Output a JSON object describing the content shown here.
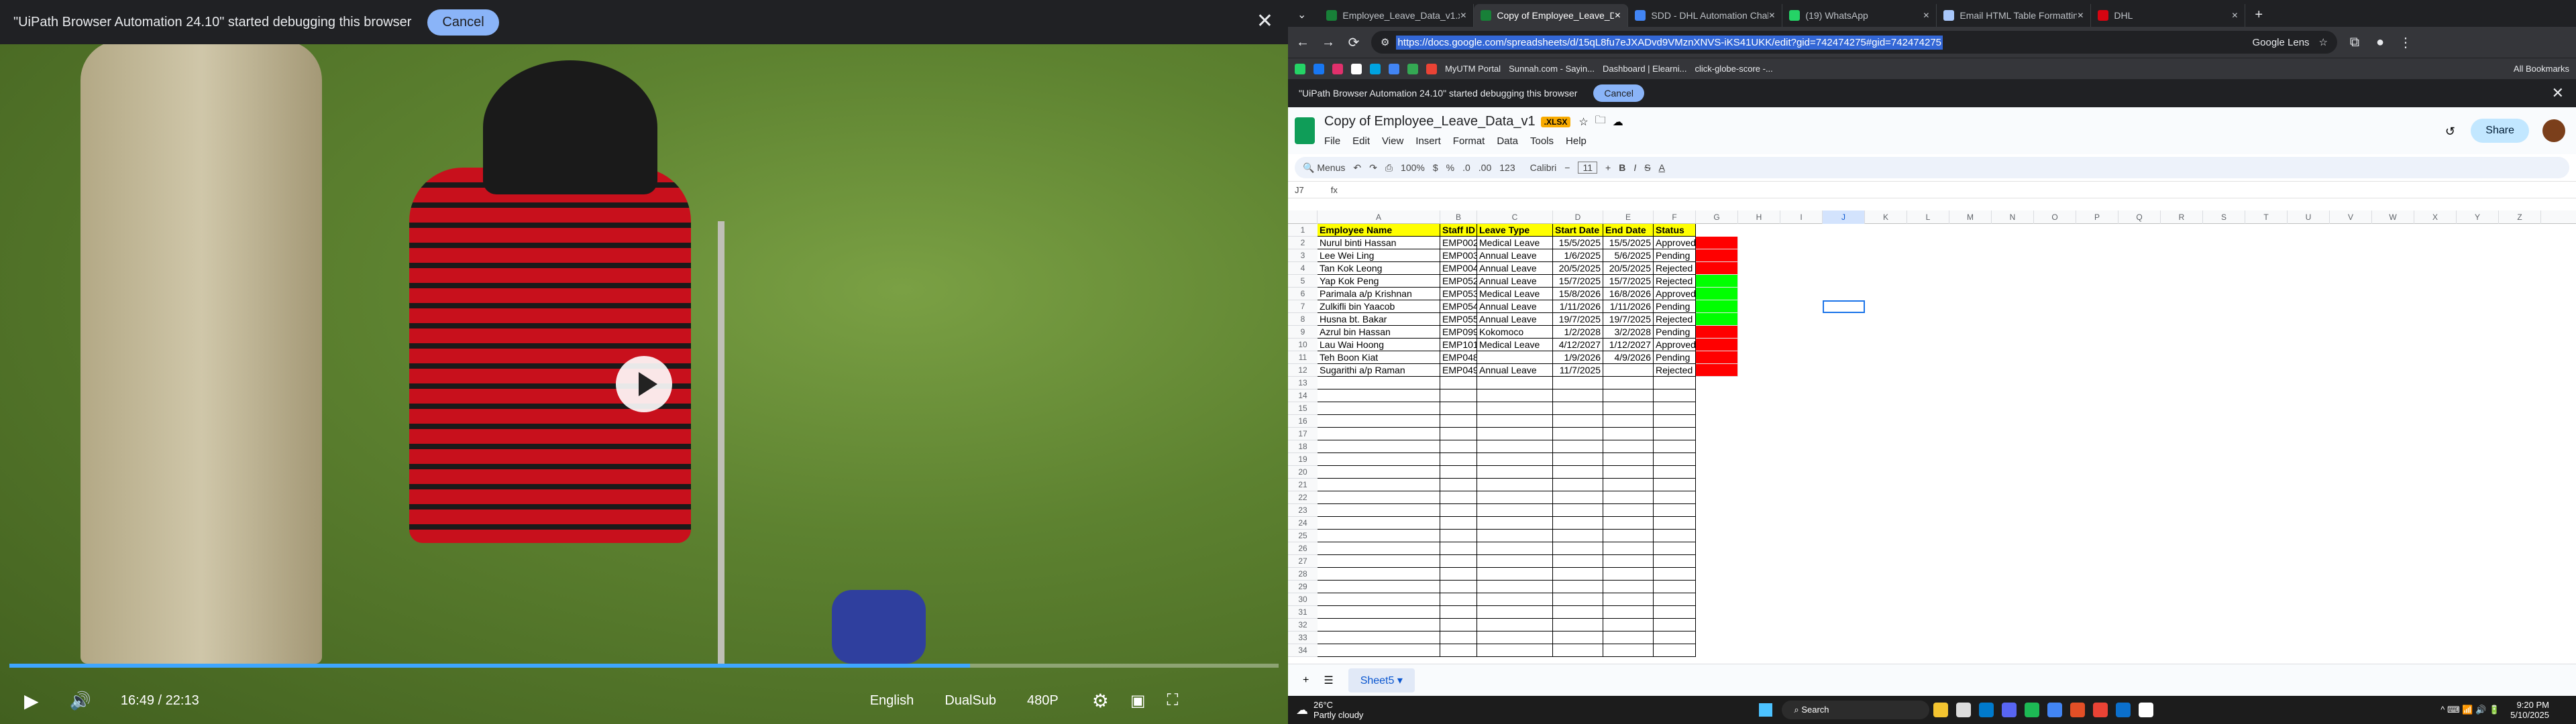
{
  "debug_banner": {
    "message": "\"UiPath Browser Automation 24.10\" started debugging this browser",
    "cancel": "Cancel"
  },
  "video": {
    "time": "16:49 / 22:13",
    "progress": 0.757,
    "audio_language": "English",
    "subtitle_mode": "DualSub",
    "quality": "480P"
  },
  "browser": {
    "tabs": [
      {
        "label": "Employee_Leave_Data_v1.xlsx",
        "color": "#188038"
      },
      {
        "label": "Copy of Employee_Leave_Data",
        "color": "#188038",
        "active": true
      },
      {
        "label": "SDD - DHL Automation Challe",
        "color": "#4285f4"
      },
      {
        "label": "(19) WhatsApp",
        "color": "#25d366"
      },
      {
        "label": "Email HTML Table Formatting",
        "color": "#a8c7fa"
      },
      {
        "label": "DHL",
        "color": "#d40511"
      }
    ],
    "url": "https://docs.google.com/spreadsheets/d/15qL8fu7eJXADvd9VMznXNVS-iKS41UKK/edit?gid=742474275#gid=742474275",
    "lens": "Google Lens",
    "bookmarks": [
      "MyUTM Portal",
      "Sunnah.com - Sayin...",
      "Dashboard | Elearni...",
      "click-globe-score -..."
    ],
    "all_bookmarks": "All Bookmarks"
  },
  "sheet": {
    "title": "Copy of Employee_Leave_Data_v1",
    "badge": ".XLSX",
    "menus": [
      "File",
      "Edit",
      "View",
      "Insert",
      "Format",
      "Data",
      "Tools",
      "Help"
    ],
    "share": "Share",
    "toolbar": {
      "menus": "Menus",
      "zoom": "100%",
      "currency": "$",
      "percent": "%",
      "dec_less": ".0",
      "dec_more": ".00",
      "num_fmt": "123",
      "font": "Calibri",
      "size": "11"
    },
    "namebox": "J7",
    "fx": "fx",
    "columns": [
      "A",
      "B",
      "C",
      "D",
      "E",
      "F",
      "G",
      "H",
      "I",
      "J",
      "K",
      "L",
      "M",
      "N",
      "O",
      "P",
      "Q",
      "R",
      "S",
      "T",
      "U",
      "V",
      "W",
      "X",
      "Y",
      "Z"
    ],
    "headers": [
      "Employee Name",
      "Staff ID",
      "Leave Type",
      "Start Date",
      "End Date",
      "Status"
    ],
    "rows": [
      [
        "Nurul binti Hassan",
        "EMP002",
        "Medical Leave",
        "15/5/2025",
        "15/5/2025",
        "Approved"
      ],
      [
        "Lee Wei Ling",
        "EMP003",
        "Annual Leave",
        "1/6/2025",
        "5/6/2025",
        "Pending"
      ],
      [
        "Tan Kok Leong",
        "EMP004",
        "Annual Leave",
        "20/5/2025",
        "20/5/2025",
        "Rejected"
      ],
      [
        "Yap Kok Peng",
        "EMP052",
        "Annual Leave",
        "15/7/2025",
        "15/7/2025",
        "Rejected"
      ],
      [
        "Parimala a/p Krishnan",
        "EMP053",
        "Medical Leave",
        "15/8/2026",
        "16/8/2026",
        "Approved"
      ],
      [
        "Zulkifli bin Yaacob",
        "EMP054",
        "Annual Leave",
        "1/11/2026",
        "1/11/2026",
        "Pending"
      ],
      [
        "Husna bt. Bakar",
        "EMP055",
        "Annual Leave",
        "19/7/2025",
        "19/7/2025",
        "Rejected"
      ],
      [
        "Azrul bin Hassan",
        "EMP099",
        "Kokomoco",
        "1/2/2028",
        "3/2/2028",
        "Pending"
      ],
      [
        "Lau Wai Hoong",
        "EMP101",
        "Medical Leave",
        "4/12/2027",
        "1/12/2027",
        "Approved"
      ],
      [
        "Teh Boon Kiat",
        "EMP048",
        "",
        "1/9/2026",
        "4/9/2026",
        "Pending"
      ],
      [
        "Sugarithi a/p Raman",
        "EMP049",
        "Annual Leave",
        "11/7/2025",
        "",
        "Rejected"
      ]
    ],
    "g_colors": [
      "#ff0000",
      "#ff0000",
      "#ff0000",
      "#00ff00",
      "#00ff00",
      "#00ff00",
      "#00ff00",
      "#ff0000",
      "#ff0000",
      "#ff0000",
      "#ff0000"
    ],
    "sheet_tab": "Sheet5"
  },
  "taskbar": {
    "weather_temp": "26°C",
    "weather_desc": "Partly cloudy",
    "search": "Search",
    "time": "9:20 PM",
    "date": "5/10/2025"
  }
}
